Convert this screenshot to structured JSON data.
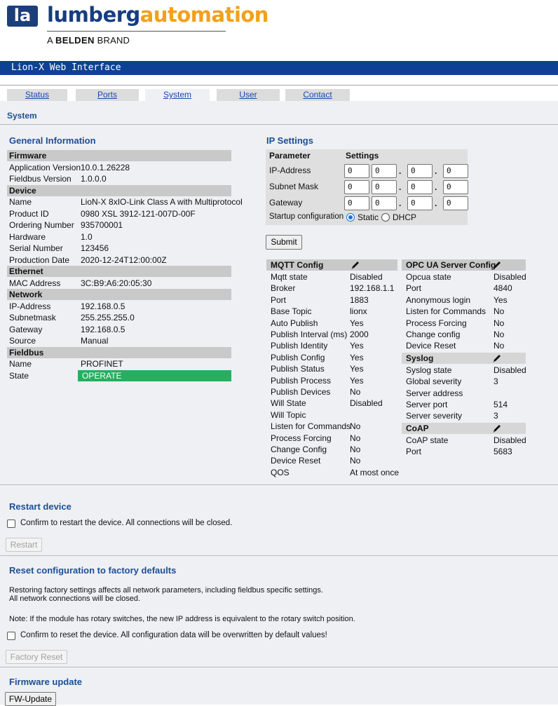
{
  "logo": {
    "part1": "lumberg",
    "part2": "automation",
    "mark": "la",
    "sub_prefix": "A",
    "sub_bold": "BELDEN",
    "sub_suffix": "BRAND"
  },
  "banner": {
    "title": "Lion-X Web Interface"
  },
  "tabs": [
    {
      "label": "Status"
    },
    {
      "label": "Ports"
    },
    {
      "label": "System",
      "active": true
    },
    {
      "label": "User"
    },
    {
      "label": "Contact"
    }
  ],
  "page_title": "System",
  "general": {
    "title": "General Information",
    "rows": [
      {
        "type": "head",
        "label": "Firmware"
      },
      {
        "label": "Application Version",
        "value": "10.0.1.26228"
      },
      {
        "label": "Fieldbus Version",
        "value": "1.0.0.0"
      },
      {
        "type": "head",
        "label": "Device"
      },
      {
        "label": "Name",
        "value": "LioN-X 8xIO-Link Class A with Multiprotocol"
      },
      {
        "label": "Product ID",
        "value": "0980 XSL 3912-121-007D-00F"
      },
      {
        "label": "Ordering Number",
        "value": "935700001"
      },
      {
        "label": "Hardware",
        "value": "1.0"
      },
      {
        "label": "Serial Number",
        "value": "123456"
      },
      {
        "label": "Production Date",
        "value": "2020-12-24T12:00:00Z"
      },
      {
        "type": "head",
        "label": "Ethernet"
      },
      {
        "label": "MAC Address",
        "value": "3C:B9:A6:20:05:30"
      },
      {
        "type": "head",
        "label": "Network"
      },
      {
        "label": "IP-Address",
        "value": "192.168.0.5"
      },
      {
        "label": "Subnetmask",
        "value": "255.255.255.0"
      },
      {
        "label": "Gateway",
        "value": "192.168.0.5"
      },
      {
        "label": "Source",
        "value": "Manual"
      },
      {
        "type": "head",
        "label": "Fieldbus"
      },
      {
        "label": "Name",
        "value": "PROFINET"
      },
      {
        "label": "State",
        "value": "OPERATE",
        "status": "ok"
      }
    ]
  },
  "ip_settings": {
    "title": "IP Settings",
    "col_parameter": "Parameter",
    "col_settings": "Settings",
    "fields": [
      {
        "label": "IP-Address",
        "octets": [
          "0",
          "0",
          "0",
          "0"
        ]
      },
      {
        "label": "Subnet Mask",
        "octets": [
          "0",
          "0",
          "0",
          "0"
        ]
      },
      {
        "label": "Gateway",
        "octets": [
          "0",
          "0",
          "0",
          "0"
        ]
      }
    ],
    "startup_label": "Startup configuration",
    "options": [
      {
        "label": "Static",
        "selected": true
      },
      {
        "label": "DHCP",
        "selected": false
      }
    ],
    "submit_label": "Submit"
  },
  "mqtt": {
    "title": "MQTT Config",
    "rows": [
      {
        "label": "Mqtt state",
        "value": "Disabled"
      },
      {
        "label": "Broker",
        "value": "192.168.1.1"
      },
      {
        "label": "Port",
        "value": "1883"
      },
      {
        "label": "Base Topic",
        "value": "lionx"
      },
      {
        "label": "Auto Publish",
        "value": "Yes"
      },
      {
        "label": "Publish Interval (ms)",
        "value": "2000"
      },
      {
        "label": "Publish Identity",
        "value": "Yes"
      },
      {
        "label": "Publish Config",
        "value": "Yes"
      },
      {
        "label": "Publish Status",
        "value": "Yes"
      },
      {
        "label": "Publish Process",
        "value": "Yes"
      },
      {
        "label": "Publish Devices",
        "value": "No"
      },
      {
        "label": "Will State",
        "value": "Disabled"
      },
      {
        "label": "Will Topic",
        "value": ""
      },
      {
        "label": "Listen for Commands",
        "value": "No"
      },
      {
        "label": "Process Forcing",
        "value": "No"
      },
      {
        "label": "Change Config",
        "value": "No"
      },
      {
        "label": "Device Reset",
        "value": "No"
      },
      {
        "label": "QOS",
        "value": "At most once"
      }
    ]
  },
  "opcua": {
    "title": "OPC UA Server Config",
    "rows": [
      {
        "label": "Opcua state",
        "value": "Disabled"
      },
      {
        "label": "Port",
        "value": "4840"
      },
      {
        "label": "Anonymous login",
        "value": "Yes"
      },
      {
        "label": "Listen for Commands",
        "value": "No"
      },
      {
        "label": "Process Forcing",
        "value": "No"
      },
      {
        "label": "Change config",
        "value": "No"
      },
      {
        "label": "Device Reset",
        "value": "No"
      }
    ]
  },
  "syslog": {
    "title": "Syslog",
    "rows": [
      {
        "label": "Syslog state",
        "value": "Disabled"
      },
      {
        "label": "Global severity",
        "value": "3"
      },
      {
        "label": "Server address",
        "value": ""
      },
      {
        "label": "Server port",
        "value": "514"
      },
      {
        "label": "Server severity",
        "value": "3"
      }
    ]
  },
  "coap": {
    "title": "CoAP",
    "rows": [
      {
        "label": "CoAP state",
        "value": "Disabled"
      },
      {
        "label": "Port",
        "value": "5683"
      }
    ]
  },
  "restart": {
    "title": "Restart device",
    "confirm": "Confirm to restart the device. All connections will be closed.",
    "button": "Restart"
  },
  "factory": {
    "title": "Reset configuration to factory defaults",
    "text1": "Restoring factory settings affects all network parameters, including fieldbus specific settings.",
    "text2": "All network connections will be closed.",
    "note": "Note: If the module has rotary switches, the new IP address is equivalent to the rotary switch position.",
    "confirm": "Confirm to reset the device. All configuration data will be overwritten by default values!",
    "button": "Factory Reset"
  },
  "firmware": {
    "title": "Firmware update",
    "button": "FW-Update"
  },
  "colors": {
    "banner": "#0e4194",
    "accent_title": "#1d4e94",
    "state_ok": "#27ae60",
    "logo_blue": "#163c82",
    "logo_orange": "#f2a11b"
  },
  "icons": {
    "edit": "pencil-icon"
  }
}
